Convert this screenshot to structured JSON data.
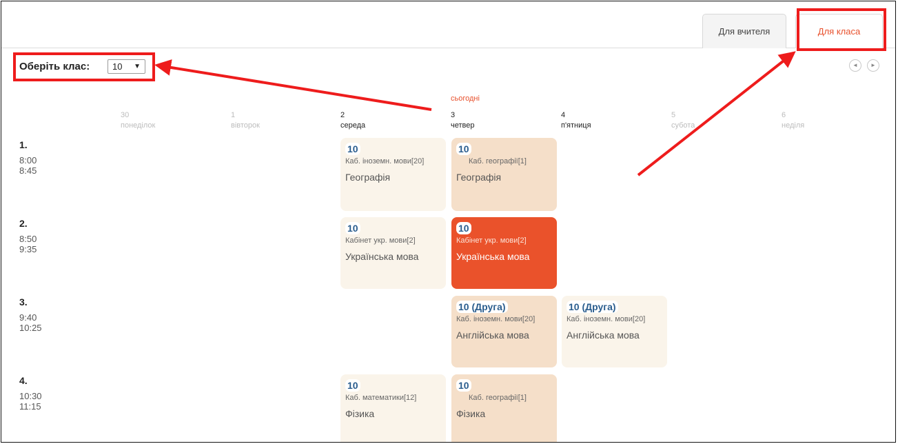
{
  "tabs": {
    "teacher": "Для вчителя",
    "class": "Для класа"
  },
  "class_selector": {
    "label": "Оберіть клас:",
    "value": "10",
    "arrow": "▼"
  },
  "nav": {
    "prev": "◄",
    "next": "►"
  },
  "today_label": "сьогодні",
  "days": [
    {
      "num": "30",
      "name": "понеділок"
    },
    {
      "num": "1",
      "name": "вівторок"
    },
    {
      "num": "2",
      "name": "середа"
    },
    {
      "num": "3",
      "name": "четвер"
    },
    {
      "num": "4",
      "name": "п'ятниця"
    },
    {
      "num": "5",
      "name": "субота"
    },
    {
      "num": "6",
      "name": "неділя"
    }
  ],
  "periods": [
    {
      "num": "1.",
      "start": "8:00",
      "end": "8:45"
    },
    {
      "num": "2.",
      "start": "8:50",
      "end": "9:35"
    },
    {
      "num": "3.",
      "start": "9:40",
      "end": "10:25"
    },
    {
      "num": "4.",
      "start": "10:30",
      "end": "11:15"
    }
  ],
  "lessons": [
    {
      "group": "10",
      "room": "Каб. іноземн. мови[20]",
      "subject": "Географія"
    },
    {
      "group": "10",
      "room": "Каб. географії[1]",
      "subject": "Географія"
    },
    {
      "group": "10",
      "room": "Кабінет укр. мови[2]",
      "subject": "Українська мова"
    },
    {
      "group": "10",
      "room": "Кабінет укр. мови[2]",
      "subject": "Українська мова"
    },
    {
      "group": "10 (Друга)",
      "room": "Каб. іноземн. мови[20]",
      "subject": "Англійська мова"
    },
    {
      "group": "10 (Друга)",
      "room": "Каб. іноземн. мови[20]",
      "subject": "Англійська мова"
    },
    {
      "group": "10",
      "room": "Каб. математики[12]",
      "subject": "Фізика"
    },
    {
      "group": "10",
      "room": "Каб. географії[1]",
      "subject": "Фізика"
    }
  ],
  "colors": {
    "accent": "#e8502c",
    "highlight": "#ee1c1c",
    "card_light": "#faf4ea",
    "card_peach": "#f5dfc9",
    "card_active": "#ea522b",
    "group_text": "#2a5d8e"
  }
}
